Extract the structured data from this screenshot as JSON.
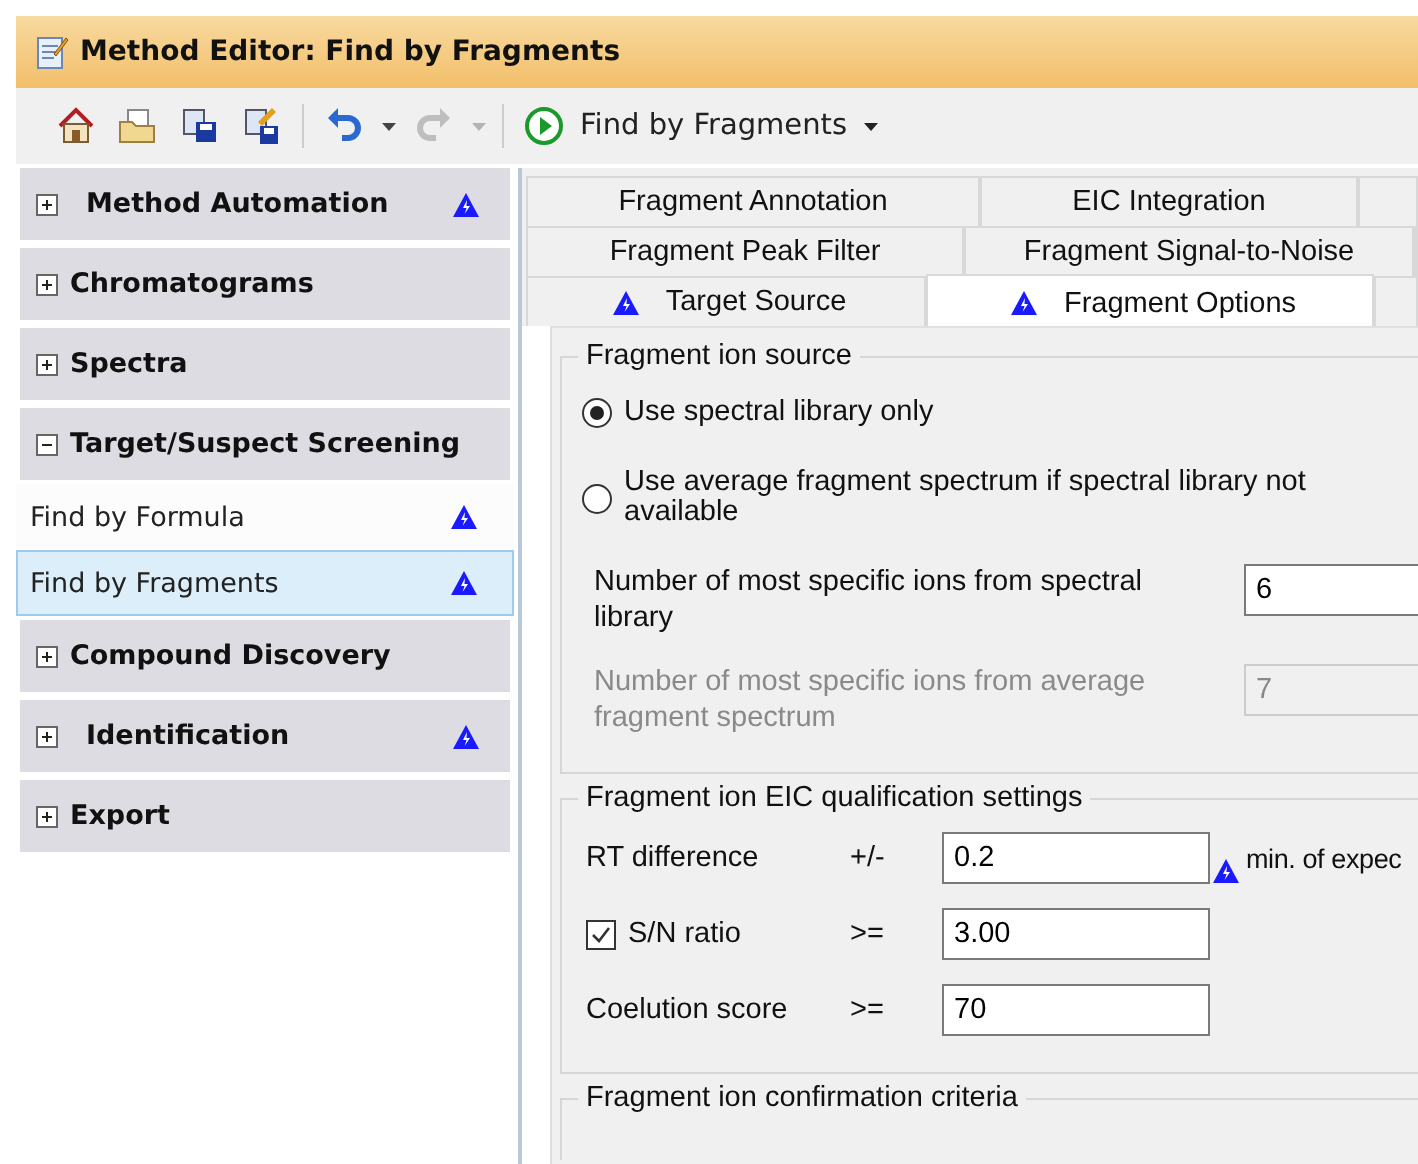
{
  "window": {
    "title": "Method Editor: Find by Fragments"
  },
  "toolbar": {
    "buttons": [
      {
        "kind": "home",
        "disabled": false
      },
      {
        "kind": "open",
        "disabled": false
      },
      {
        "kind": "save",
        "disabled": false
      },
      {
        "kind": "save_as",
        "disabled": false
      },
      {
        "kind": "sep"
      },
      {
        "kind": "undo",
        "disabled": false
      },
      {
        "kind": "caret",
        "disabled": false
      },
      {
        "kind": "redo",
        "disabled": true
      },
      {
        "kind": "caret",
        "disabled": true
      },
      {
        "kind": "sep"
      }
    ],
    "run": {
      "label": "Find by Fragments"
    }
  },
  "sidebar": {
    "sections": [
      {
        "label": "Method Automation",
        "expanded": false,
        "warning": true
      },
      {
        "label": "Chromatograms",
        "expanded": false,
        "warning": false
      },
      {
        "label": "Spectra",
        "expanded": false,
        "warning": false
      },
      {
        "label": "Target/Suspect Screening",
        "expanded": true,
        "warning": false,
        "children": [
          {
            "label": "Find by Formula",
            "selected": false,
            "warning": true
          },
          {
            "label": "Find by Fragments",
            "selected": true,
            "warning": true
          }
        ]
      },
      {
        "label": "Compound Discovery",
        "expanded": false,
        "warning": false
      },
      {
        "label": "Identification",
        "expanded": false,
        "warning": true
      },
      {
        "label": "Export",
        "expanded": false,
        "warning": false
      }
    ]
  },
  "tab_rows": [
    [
      {
        "label": "Fragment Annotation",
        "selected": false,
        "warning": false
      },
      {
        "label": "EIC Integration",
        "selected": false,
        "warning": false
      }
    ],
    [
      {
        "label": "Fragment Peak Filter",
        "selected": false,
        "warning": false
      },
      {
        "label": "Fragment Signal-to-Noise",
        "selected": false,
        "warning": false
      }
    ],
    [
      {
        "label": "Target Source",
        "selected": false,
        "warning": true
      },
      {
        "label": "Fragment Options",
        "selected": true,
        "warning": true
      }
    ]
  ],
  "fragment_ion_source": {
    "title": "Fragment ion source",
    "options": [
      {
        "label": "Use spectral library only",
        "selected": true
      },
      {
        "label": "Use average fragment spectrum if spectral library not available",
        "selected": false
      }
    ],
    "fields": [
      {
        "label": "Number of most specific ions from spectral library",
        "value": "6",
        "disabled": false
      },
      {
        "label": "Number of most specific ions from average fragment spectrum",
        "value": "7",
        "disabled": true
      }
    ]
  },
  "eic_qualification": {
    "title": "Fragment ion EIC qualification settings",
    "rows": [
      {
        "kind": "plain",
        "label": "RT difference",
        "operator": "+/-",
        "value": "0.2",
        "warning": true,
        "unit": "min. of expec"
      },
      {
        "kind": "checkbox",
        "label": "S/N ratio",
        "checked": true,
        "operator": ">=",
        "value": "3.00",
        "warning": false
      },
      {
        "kind": "plain",
        "label": "Coelution score",
        "operator": ">=",
        "value": "70",
        "warning": false
      }
    ]
  },
  "confirmation": {
    "title": "Fragment ion confirmation criteria"
  }
}
